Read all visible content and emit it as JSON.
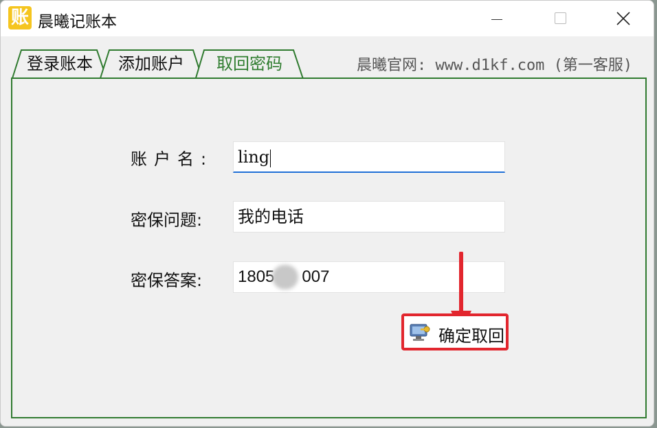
{
  "window": {
    "icon_char": "账",
    "title": "晨曦记账本"
  },
  "tabs": [
    {
      "label": "登录账本",
      "active": false
    },
    {
      "label": "添加账户",
      "active": false
    },
    {
      "label": "取回密码",
      "active": true
    }
  ],
  "website": "晨曦官网: www.d1kf.com (第一客服)",
  "form": {
    "account_label": "账户名:",
    "account_value": "ling",
    "question_label": "密保问题:",
    "question_value": "我的电话",
    "answer_label": "密保答案:",
    "answer_value_visible": "1805      007"
  },
  "confirm_button": {
    "label": "确定取回"
  },
  "colors": {
    "accent_green": "#2f7a2f",
    "highlight_red": "#e2262e",
    "focus_blue": "#1f6fd6",
    "app_icon": "#f5c51f"
  }
}
